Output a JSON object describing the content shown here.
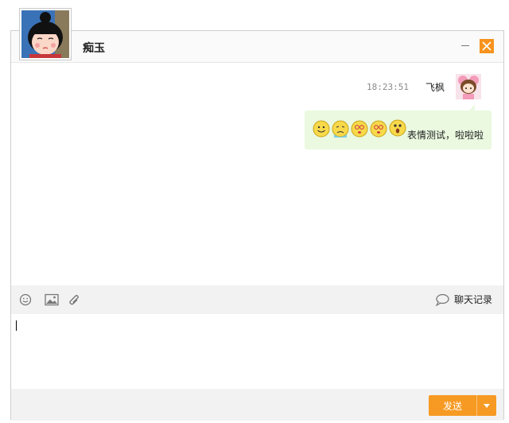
{
  "header": {
    "contact_name": "痴玉"
  },
  "conversation": {
    "messages": [
      {
        "time": "18:23:51",
        "sender": "飞枫",
        "text": "表情测试，啦啦啦",
        "emojis": [
          "smile-emoji",
          "cry-emoji",
          "dizzy-emoji",
          "dizzy-emoji",
          "surprised-emoji"
        ]
      }
    ]
  },
  "toolbar": {
    "history_label": "聊天记录",
    "icons": [
      "smiley-icon",
      "image-icon",
      "attachment-icon"
    ]
  },
  "footer": {
    "send_label": "发送"
  },
  "colors": {
    "accent": "#F7931E",
    "bubble": "#EAF9E0",
    "toolbar_bg": "#F2F2F2"
  }
}
